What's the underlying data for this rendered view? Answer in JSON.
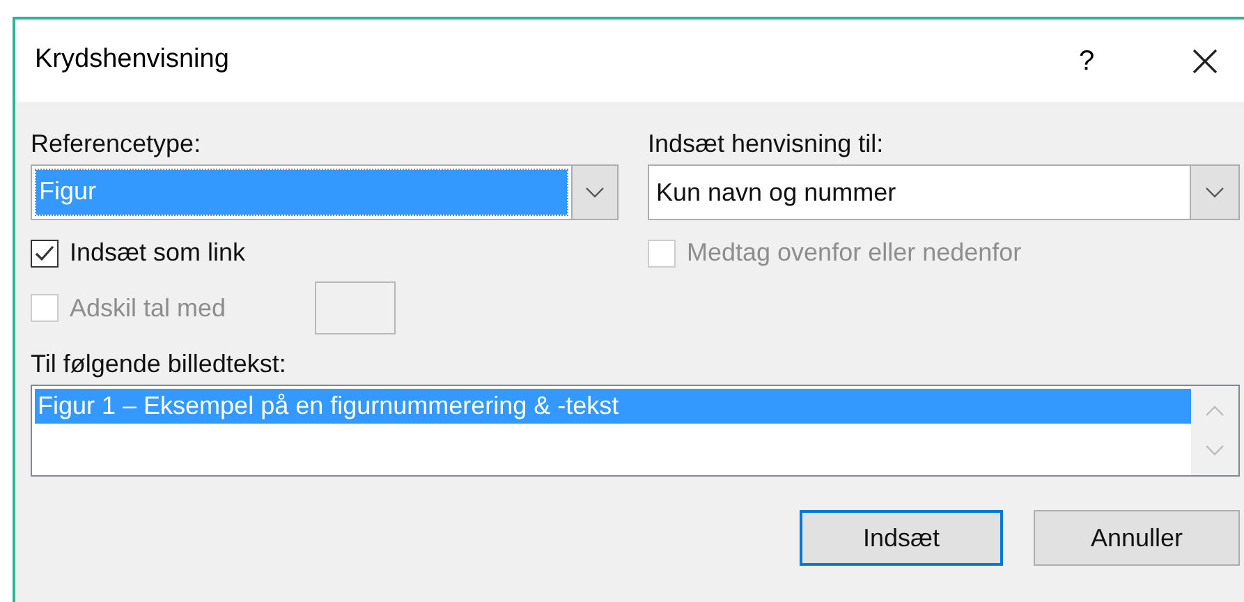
{
  "window": {
    "title": "Krydshenvisning",
    "help": "?"
  },
  "reference_type": {
    "label": "Referencetype:",
    "value": "Figur"
  },
  "insert_reference_to": {
    "label": "Indsæt henvisning til:",
    "value": "Kun navn og nummer"
  },
  "checkboxes": [
    {
      "label": "Indsæt som link",
      "checked": true,
      "disabled": false
    },
    {
      "label": "Medtag ovenfor eller nedenfor",
      "checked": false,
      "disabled": true
    },
    {
      "label": "Adskil tal med",
      "checked": false,
      "disabled": true
    }
  ],
  "captions": {
    "label": "Til følgende billedtekst:",
    "items": [
      {
        "text": "Figur 1 – Eksempel på en figurnummerering & -tekst",
        "selected": true
      }
    ]
  },
  "buttons": [
    {
      "label": "Indsæt",
      "default": true
    },
    {
      "label": "Annuller",
      "default": false
    }
  ]
}
